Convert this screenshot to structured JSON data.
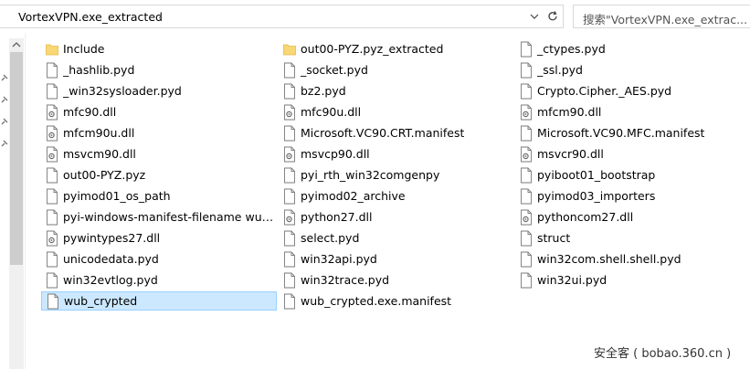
{
  "address_bar": {
    "path": "VortexVPN.exe_extracted",
    "separator": "›"
  },
  "search": {
    "placeholder": "搜索\"VortexVPN.exe_extrac..."
  },
  "files": [
    {
      "name": "Include",
      "type": "folder",
      "col": 0,
      "row": 0
    },
    {
      "name": "_hashlib.pyd",
      "type": "file",
      "col": 0,
      "row": 1
    },
    {
      "name": "_win32sysloader.pyd",
      "type": "file",
      "col": 0,
      "row": 2
    },
    {
      "name": "mfc90.dll",
      "type": "dll",
      "col": 0,
      "row": 3
    },
    {
      "name": "mfcm90u.dll",
      "type": "dll",
      "col": 0,
      "row": 4
    },
    {
      "name": "msvcm90.dll",
      "type": "dll",
      "col": 0,
      "row": 5
    },
    {
      "name": "out00-PYZ.pyz",
      "type": "file",
      "col": 0,
      "row": 6
    },
    {
      "name": "pyimod01_os_path",
      "type": "file",
      "col": 0,
      "row": 7
    },
    {
      "name": "pyi-windows-manifest-filename wub_c...",
      "type": "file",
      "col": 0,
      "row": 8
    },
    {
      "name": "pywintypes27.dll",
      "type": "dll",
      "col": 0,
      "row": 9
    },
    {
      "name": "unicodedata.pyd",
      "type": "file",
      "col": 0,
      "row": 10
    },
    {
      "name": "win32evtlog.pyd",
      "type": "file",
      "col": 0,
      "row": 11
    },
    {
      "name": "wub_crypted",
      "type": "file",
      "col": 0,
      "row": 12,
      "selected": true
    },
    {
      "name": "out00-PYZ.pyz_extracted",
      "type": "folder",
      "col": 1,
      "row": 0
    },
    {
      "name": "_socket.pyd",
      "type": "file",
      "col": 1,
      "row": 1
    },
    {
      "name": "bz2.pyd",
      "type": "file",
      "col": 1,
      "row": 2
    },
    {
      "name": "mfc90u.dll",
      "type": "dll",
      "col": 1,
      "row": 3
    },
    {
      "name": "Microsoft.VC90.CRT.manifest",
      "type": "file",
      "col": 1,
      "row": 4
    },
    {
      "name": "msvcp90.dll",
      "type": "dll",
      "col": 1,
      "row": 5
    },
    {
      "name": "pyi_rth_win32comgenpy",
      "type": "file",
      "col": 1,
      "row": 6
    },
    {
      "name": "pyimod02_archive",
      "type": "file",
      "col": 1,
      "row": 7
    },
    {
      "name": "python27.dll",
      "type": "dll",
      "col": 1,
      "row": 8
    },
    {
      "name": "select.pyd",
      "type": "file",
      "col": 1,
      "row": 9
    },
    {
      "name": "win32api.pyd",
      "type": "file",
      "col": 1,
      "row": 10
    },
    {
      "name": "win32trace.pyd",
      "type": "file",
      "col": 1,
      "row": 11
    },
    {
      "name": "wub_crypted.exe.manifest",
      "type": "file",
      "col": 1,
      "row": 12
    },
    {
      "name": "_ctypes.pyd",
      "type": "file",
      "col": 2,
      "row": 0
    },
    {
      "name": "_ssl.pyd",
      "type": "file",
      "col": 2,
      "row": 1
    },
    {
      "name": "Crypto.Cipher._AES.pyd",
      "type": "file",
      "col": 2,
      "row": 2
    },
    {
      "name": "mfcm90.dll",
      "type": "dll",
      "col": 2,
      "row": 3
    },
    {
      "name": "Microsoft.VC90.MFC.manifest",
      "type": "file",
      "col": 2,
      "row": 4
    },
    {
      "name": "msvcr90.dll",
      "type": "dll",
      "col": 2,
      "row": 5
    },
    {
      "name": "pyiboot01_bootstrap",
      "type": "file",
      "col": 2,
      "row": 6
    },
    {
      "name": "pyimod03_importers",
      "type": "file",
      "col": 2,
      "row": 7
    },
    {
      "name": "pythoncom27.dll",
      "type": "dll",
      "col": 2,
      "row": 8
    },
    {
      "name": "struct",
      "type": "file",
      "col": 2,
      "row": 9
    },
    {
      "name": "win32com.shell.shell.pyd",
      "type": "file",
      "col": 2,
      "row": 10
    },
    {
      "name": "win32ui.pyd",
      "type": "file",
      "col": 2,
      "row": 11
    }
  ],
  "watermark": "安全客 ( bobao.360.cn )",
  "colors": {
    "folder": "#f8d775",
    "folder_dark": "#e8b94a",
    "selection_bg": "#cce8ff",
    "selection_border": "#99d1ff"
  }
}
